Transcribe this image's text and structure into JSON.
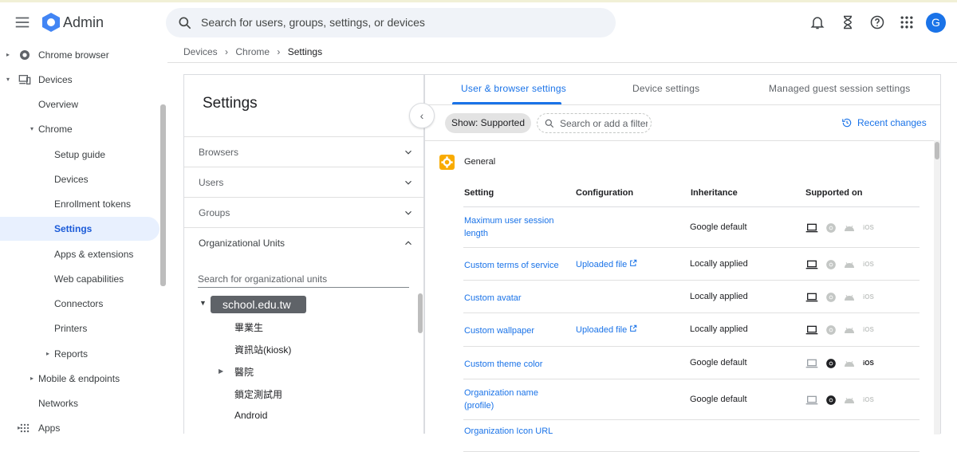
{
  "header": {
    "app_title": "Admin",
    "search_placeholder": "Search for users, groups, settings, or devices",
    "avatar_initial": "G",
    "icons": [
      "notifications-icon",
      "hourglass-icon",
      "help-icon",
      "apps-grid-icon"
    ]
  },
  "nav": {
    "items": [
      {
        "label": "Chrome browser",
        "caret": "▸"
      },
      {
        "label": "Devices",
        "caret": "▾"
      },
      {
        "label": "Overview"
      },
      {
        "label": "Chrome",
        "caret": "▾"
      },
      {
        "label": "Setup guide"
      },
      {
        "label": "Devices"
      },
      {
        "label": "Enrollment tokens"
      },
      {
        "label": "Settings",
        "active": true
      },
      {
        "label": "Apps & extensions"
      },
      {
        "label": "Web capabilities"
      },
      {
        "label": "Connectors"
      },
      {
        "label": "Printers"
      },
      {
        "label": "Reports",
        "caret": "▸"
      },
      {
        "label": "Mobile & endpoints",
        "caret": "▸"
      },
      {
        "label": "Networks"
      },
      {
        "label": "Apps",
        "caret": "▸"
      }
    ]
  },
  "breadcrumb": {
    "items": [
      "Devices",
      "Chrome"
    ],
    "current": "Settings",
    "separator": "›"
  },
  "settings_panel": {
    "title": "Settings",
    "sections": [
      "Browsers",
      "Users",
      "Groups",
      "Organizational Units"
    ],
    "ou_search_placeholder": "Search for organizational units",
    "ou_root": "school.edu.tw",
    "ou_children": [
      "畢業生",
      "資訊站(kiosk)",
      "醫院",
      "鎖定測試用",
      "Android"
    ]
  },
  "tabs": [
    "User & browser settings",
    "Device settings",
    "Managed guest session settings"
  ],
  "filters": {
    "chip": "Show: Supported",
    "placeholder": "Search or add a filter",
    "recent_changes": "Recent changes"
  },
  "table": {
    "group_title": "General",
    "headers": [
      "Setting",
      "Configuration",
      "Inheritance",
      "Supported on"
    ],
    "rows": [
      {
        "setting": "Maximum user session length",
        "config": "",
        "inheritance": "Google default",
        "supported": [
          true,
          false,
          false,
          false
        ]
      },
      {
        "setting": "Custom terms of service",
        "config": "Uploaded file",
        "inheritance": "Locally applied",
        "supported": [
          true,
          false,
          false,
          false
        ]
      },
      {
        "setting": "Custom avatar",
        "config": "",
        "inheritance": "Locally applied",
        "supported": [
          true,
          false,
          false,
          false
        ]
      },
      {
        "setting": "Custom wallpaper",
        "config": "Uploaded file",
        "inheritance": "Locally applied",
        "supported": [
          true,
          false,
          false,
          false
        ]
      },
      {
        "setting": "Custom theme color",
        "config": "",
        "inheritance": "Google default",
        "supported": [
          false,
          true,
          false,
          true
        ]
      },
      {
        "setting": "Organization name (profile)",
        "config": "",
        "inheritance": "Google default",
        "supported": [
          false,
          true,
          false,
          false
        ]
      },
      {
        "setting": "Organization Icon URL",
        "config": "",
        "inheritance": "",
        "supported": [
          false,
          true,
          false,
          false
        ]
      }
    ],
    "platform_icons": [
      "laptop-icon",
      "chrome-icon",
      "android-icon",
      "ios-icon"
    ],
    "ios_label": "iOS"
  },
  "colors": {
    "accent": "#1a73e8",
    "active_bg": "#e8f0fe",
    "general_icon": "#f9ab00"
  }
}
